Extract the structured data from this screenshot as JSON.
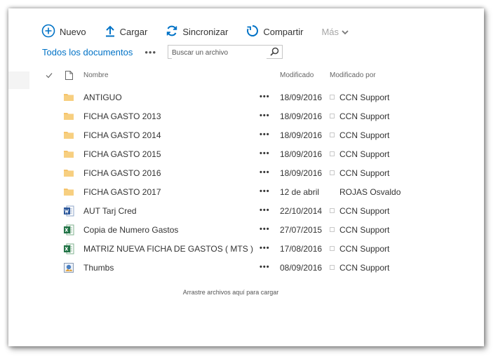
{
  "toolbar": {
    "new_label": "Nuevo",
    "upload_label": "Cargar",
    "sync_label": "Sincronizar",
    "share_label": "Compartir",
    "more_label": "Más"
  },
  "views": {
    "all_documents": "Todos los documentos",
    "more_dots": "•••"
  },
  "search": {
    "placeholder": "Buscar un archivo"
  },
  "columns": {
    "name": "Nombre",
    "modified": "Modificado",
    "modified_by": "Modificado por"
  },
  "files": [
    {
      "type": "folder",
      "name": "ANTIGUO",
      "modified": "18/09/2016",
      "modified_by": "CCN Support",
      "presence": true
    },
    {
      "type": "folder",
      "name": "FICHA GASTO 2013",
      "modified": "18/09/2016",
      "modified_by": "CCN Support",
      "presence": true
    },
    {
      "type": "folder",
      "name": "FICHA GASTO 2014",
      "modified": "18/09/2016",
      "modified_by": "CCN Support",
      "presence": true
    },
    {
      "type": "folder",
      "name": "FICHA GASTO 2015",
      "modified": "18/09/2016",
      "modified_by": "CCN Support",
      "presence": true
    },
    {
      "type": "folder",
      "name": "FICHA GASTO 2016",
      "modified": "18/09/2016",
      "modified_by": "CCN Support",
      "presence": true
    },
    {
      "type": "folder",
      "name": "FICHA GASTO 2017",
      "modified": "12 de abril",
      "modified_by": "ROJAS Osvaldo",
      "presence": false
    },
    {
      "type": "word",
      "name": "AUT Tarj Cred",
      "modified": "22/10/2014",
      "modified_by": "CCN Support",
      "presence": true
    },
    {
      "type": "excel",
      "name": "Copia de Numero Gastos",
      "modified": "27/07/2015",
      "modified_by": "CCN Support",
      "presence": true
    },
    {
      "type": "excel",
      "name": "MATRIZ NUEVA FICHA DE GASTOS ( MTS )",
      "modified": "17/08/2016",
      "modified_by": "CCN Support",
      "presence": true
    },
    {
      "type": "image",
      "name": "Thumbs",
      "modified": "08/09/2016",
      "modified_by": "CCN Support",
      "presence": true
    }
  ],
  "row_dots": "•••",
  "footer": {
    "drop_hint": "Arrastre archivos aquí para cargar"
  },
  "colors": {
    "accent": "#0072c6",
    "folder": "#f5c36a",
    "word": "#2b579a",
    "excel": "#217346"
  }
}
